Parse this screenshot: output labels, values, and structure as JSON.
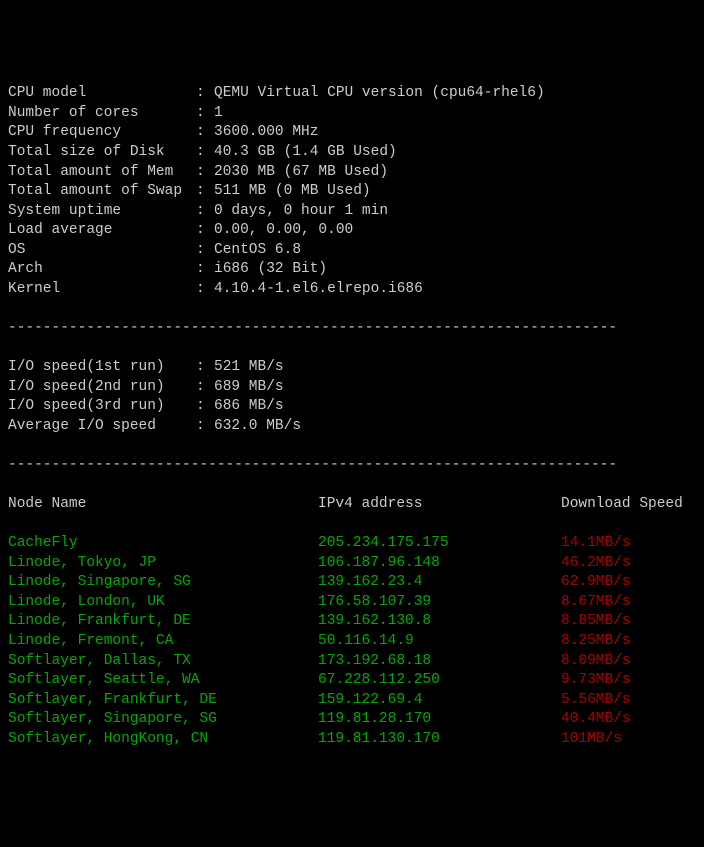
{
  "sysinfo": [
    {
      "label": "CPU model",
      "value": "QEMU Virtual CPU version (cpu64-rhel6)"
    },
    {
      "label": "Number of cores",
      "value": "1"
    },
    {
      "label": "CPU frequency",
      "value": "3600.000 MHz"
    },
    {
      "label": "Total size of Disk",
      "value": "40.3 GB (1.4 GB Used)"
    },
    {
      "label": "Total amount of Mem",
      "value": "2030 MB (67 MB Used)"
    },
    {
      "label": "Total amount of Swap",
      "value": "511 MB (0 MB Used)"
    },
    {
      "label": "System uptime",
      "value": "0 days, 0 hour 1 min"
    },
    {
      "label": "Load average",
      "value": "0.00, 0.00, 0.00"
    },
    {
      "label": "OS",
      "value": "CentOS 6.8"
    },
    {
      "label": "Arch",
      "value": "i686 (32 Bit)"
    },
    {
      "label": "Kernel",
      "value": "4.10.4-1.el6.elrepo.i686"
    }
  ],
  "iospeed": [
    {
      "label": "I/O speed(1st run)",
      "value": "521 MB/s"
    },
    {
      "label": "I/O speed(2nd run)",
      "value": "689 MB/s"
    },
    {
      "label": "I/O speed(3rd run)",
      "value": "686 MB/s"
    },
    {
      "label": "Average I/O speed",
      "value": "632.0 MB/s"
    }
  ],
  "nodeheader": {
    "node": "Node Name",
    "ip": "IPv4 address",
    "speed": "Download Speed"
  },
  "nodes": [
    {
      "name": "CacheFly",
      "ip": "205.234.175.175",
      "speed": "14.1MB/s"
    },
    {
      "name": "Linode, Tokyo, JP",
      "ip": "106.187.96.148",
      "speed": "46.2MB/s"
    },
    {
      "name": "Linode, Singapore, SG",
      "ip": "139.162.23.4",
      "speed": "62.9MB/s"
    },
    {
      "name": "Linode, London, UK",
      "ip": "176.58.107.39",
      "speed": "8.67MB/s"
    },
    {
      "name": "Linode, Frankfurt, DE",
      "ip": "139.162.130.8",
      "speed": "8.85MB/s"
    },
    {
      "name": "Linode, Fremont, CA",
      "ip": "50.116.14.9",
      "speed": "8.25MB/s"
    },
    {
      "name": "Softlayer, Dallas, TX",
      "ip": "173.192.68.18",
      "speed": "8.09MB/s"
    },
    {
      "name": "Softlayer, Seattle, WA",
      "ip": "67.228.112.250",
      "speed": "9.73MB/s"
    },
    {
      "name": "Softlayer, Frankfurt, DE",
      "ip": "159.122.69.4",
      "speed": "5.56MB/s"
    },
    {
      "name": "Softlayer, Singapore, SG",
      "ip": "119.81.28.170",
      "speed": "40.4MB/s"
    },
    {
      "name": "Softlayer, HongKong, CN",
      "ip": "119.81.130.170",
      "speed": "101MB/s"
    }
  ],
  "divider": "----------------------------------------------------------------------"
}
